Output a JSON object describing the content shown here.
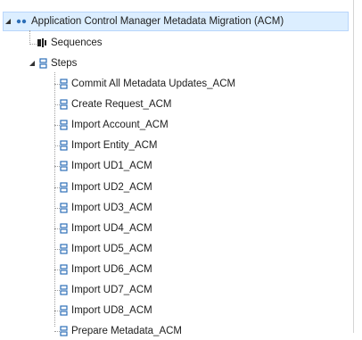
{
  "tree": {
    "root": {
      "label": "Application Control Manager Metadata Migration (ACM)",
      "icon": "workflow-dots-icon",
      "expanded": true,
      "selected": true
    },
    "sequences": {
      "label": "Sequences",
      "icon": "sequence-icon"
    },
    "steps": {
      "label": "Steps",
      "icon": "step-icon",
      "expanded": true,
      "items": [
        {
          "label": "Commit All Metadata Updates_ACM"
        },
        {
          "label": "Create Request_ACM"
        },
        {
          "label": "Import Account_ACM"
        },
        {
          "label": "Import Entity_ACM"
        },
        {
          "label": "Import UD1_ACM"
        },
        {
          "label": "Import UD2_ACM"
        },
        {
          "label": "Import UD3_ACM"
        },
        {
          "label": "Import UD4_ACM"
        },
        {
          "label": "Import UD5_ACM"
        },
        {
          "label": "Import UD6_ACM"
        },
        {
          "label": "Import UD7_ACM"
        },
        {
          "label": "Import UD8_ACM"
        },
        {
          "label": "Prepare Metadata_ACM"
        }
      ]
    }
  },
  "colors": {
    "icon_blue": "#2d6fb7",
    "selection": "#dceeff"
  }
}
